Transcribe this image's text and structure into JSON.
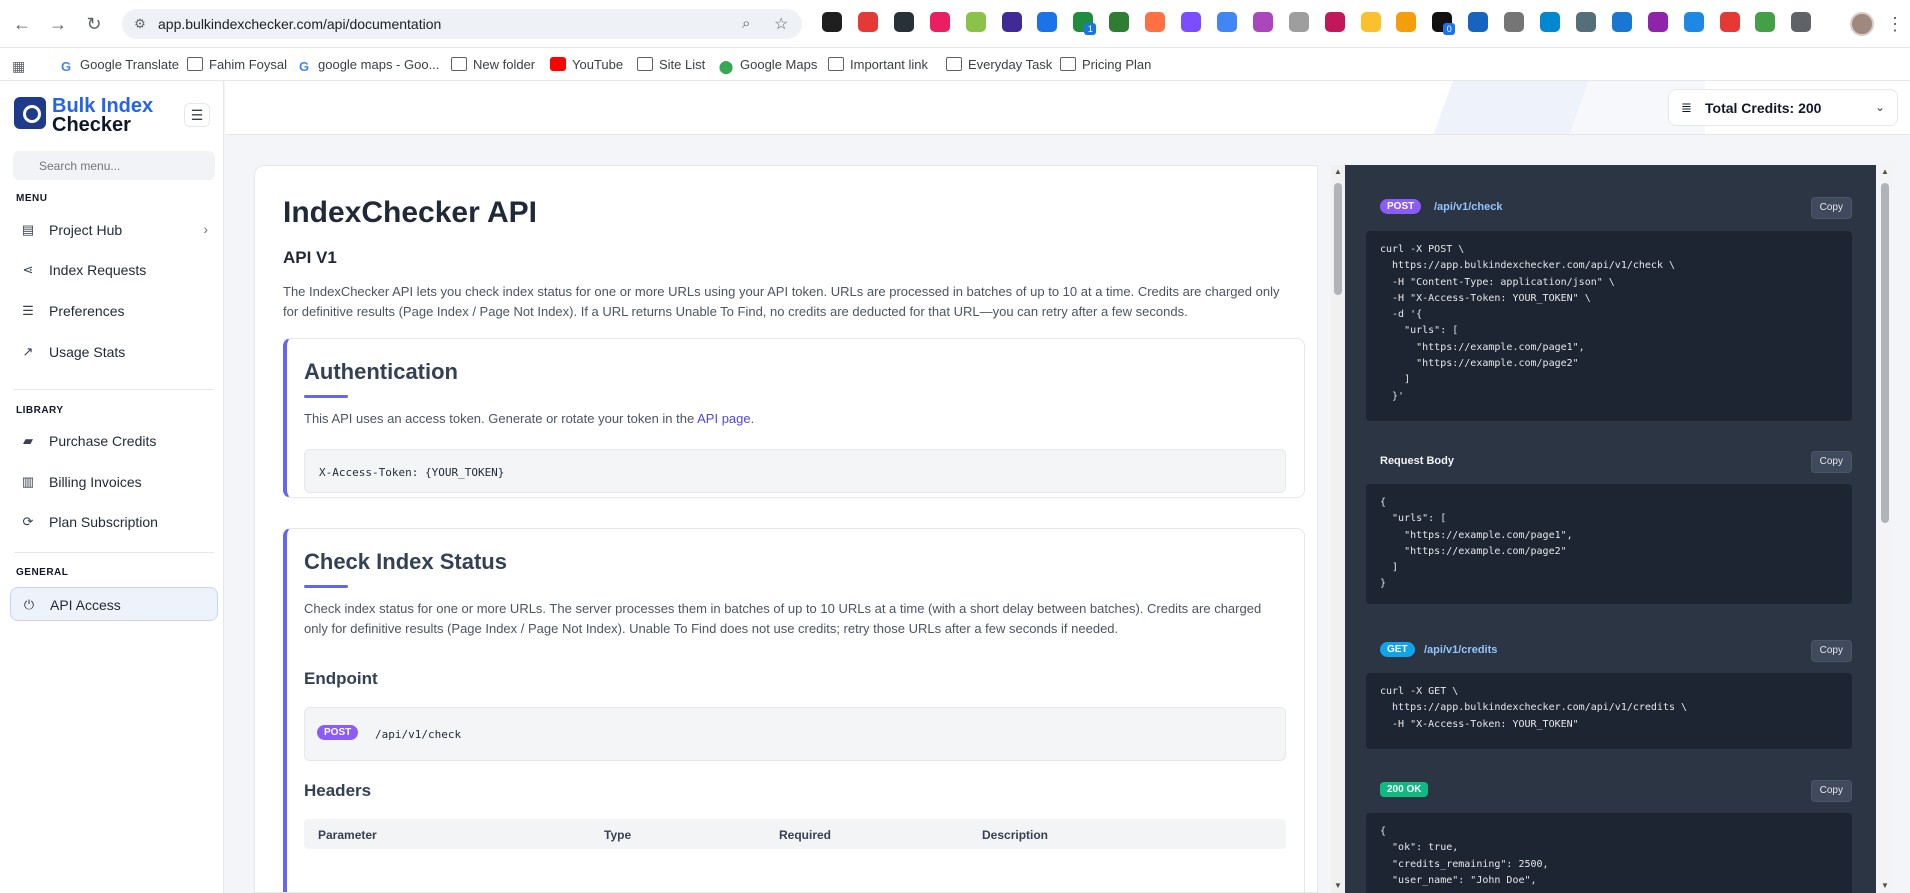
{
  "browser": {
    "url": "app.bulkindexchecker.com/api/documentation",
    "bookmarks": [
      {
        "label": "Google Translate",
        "icon": "google-icon"
      },
      {
        "label": "Fahim Foysal",
        "icon": "folder-icon"
      },
      {
        "label": "google maps - Goo...",
        "icon": "google-icon"
      },
      {
        "label": "New folder",
        "icon": "folder-icon"
      },
      {
        "label": "YouTube",
        "icon": "youtube-icon"
      },
      {
        "label": "Site List",
        "icon": "folder-icon"
      },
      {
        "label": "Google Maps",
        "icon": "maps-pin-icon"
      },
      {
        "label": "Important link",
        "icon": "folder-icon"
      },
      {
        "label": "Everyday Task",
        "icon": "folder-icon"
      },
      {
        "label": "Pricing Plan",
        "icon": "folder-icon"
      }
    ],
    "extension_badges": {
      "ext7": "1",
      "ext17": "0"
    },
    "colors": {
      "extensions": [
        "#1f1f1f",
        "#e53935",
        "#263238",
        "#e91e63",
        "#8bc34a",
        "#3f2b96",
        "#1a73e8",
        "#1e8e3e",
        "#2e7d32",
        "#ff7043",
        "#7c4dff",
        "#4285f4",
        "#ab47bc",
        "#9e9e9e",
        "#c2185b",
        "#fbc02d",
        "#f59e0b",
        "#111111",
        "#1565c0",
        "#757575",
        "#0288d1",
        "#546e7a",
        "#1976d2",
        "#8e24aa",
        "#1e88e5",
        "#e53935",
        "#43a047",
        "#5f6368"
      ]
    }
  },
  "sidebar": {
    "logo_line1": "Bulk Index",
    "logo_line2": "Checker",
    "search_placeholder": "Search menu...",
    "sections": {
      "menu": "MENU",
      "library": "LIBRARY",
      "general": "GENERAL"
    },
    "items": [
      {
        "label": "Project Hub",
        "icon": "project-hub-icon"
      },
      {
        "label": "Index Requests",
        "icon": "share-icon"
      },
      {
        "label": "Preferences",
        "icon": "sliders-icon"
      },
      {
        "label": "Usage Stats",
        "icon": "chart-line-icon"
      },
      {
        "label": "Purchase Credits",
        "icon": "wallet-icon"
      },
      {
        "label": "Billing Invoices",
        "icon": "receipt-icon"
      },
      {
        "label": "Plan Subscription",
        "icon": "refresh-icon"
      },
      {
        "label": "API Access",
        "icon": "plug-icon",
        "active": true
      }
    ]
  },
  "header": {
    "credits_label": "Total Credits: 200"
  },
  "main": {
    "title": "IndexChecker API",
    "version": "API V1",
    "intro": "The IndexChecker API lets you check index status for one or more URLs using your API token. URLs are processed in batches of up to 10 at a time. Credits are charged only for definitive results (Page Index / Page Not Index). If a URL returns Unable To Find, no credits are deducted for that URL—you can retry after a few seconds.",
    "auth": {
      "title": "Authentication",
      "text_before": "This API uses an access token. Generate or rotate your token in the ",
      "link": "API page",
      "text_after": ".",
      "code": "X-Access-Token: {YOUR_TOKEN}"
    },
    "check": {
      "title": "Check Index Status",
      "text": "Check index status for one or more URLs. The server processes them in batches of up to 10 URLs at a time (with a short delay between batches). Credits are charged only for definitive results (Page Index / Page Not Index). Unable To Find does not use credits; retry those URLs after a few seconds if needed.",
      "endpoint_heading": "Endpoint",
      "endpoint_method": "POST",
      "endpoint_path": "/api/v1/check",
      "headers_heading": "Headers",
      "table_columns": [
        "Parameter",
        "Type",
        "Required",
        "Description"
      ]
    }
  },
  "code_panel": {
    "copy_label": "Copy",
    "blocks": [
      {
        "method": "POST",
        "path": "/api/v1/check",
        "code": "curl -X POST \\\n  https://app.bulkindexchecker.com/api/v1/check \\\n  -H \"Content-Type: application/json\" \\\n  -H \"X-Access-Token: YOUR_TOKEN\" \\\n  -d '{\n    \"urls\": [\n      \"https://example.com/page1\",\n      \"https://example.com/page2\"\n    ]\n  }'"
      },
      {
        "label": "Request Body",
        "code": "{\n  \"urls\": [\n    \"https://example.com/page1\",\n    \"https://example.com/page2\"\n  ]\n}"
      },
      {
        "method": "GET",
        "path": "/api/v1/credits",
        "code": "curl -X GET \\\n  https://app.bulkindexchecker.com/api/v1/credits \\\n  -H \"X-Access-Token: YOUR_TOKEN\""
      },
      {
        "status": "200 OK",
        "code": "{\n  \"ok\": true,\n  \"credits_remaining\": 2500,\n  \"user_name\": \"John Doe\","
      }
    ]
  }
}
